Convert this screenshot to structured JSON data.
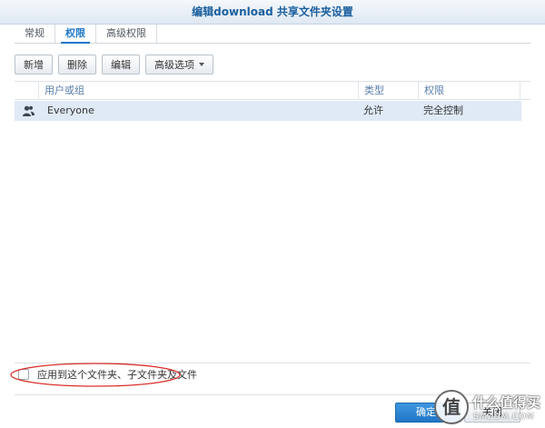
{
  "window": {
    "title": "编辑download 共享文件夹设置"
  },
  "tabs": [
    {
      "label": "常规",
      "active": false
    },
    {
      "label": "权限",
      "active": true
    },
    {
      "label": "高级权限",
      "active": false
    }
  ],
  "toolbar": {
    "add_label": "新增",
    "delete_label": "删除",
    "edit_label": "编辑",
    "advanced_label": "高级选项"
  },
  "grid": {
    "columns": [
      "用户或组",
      "类型",
      "权限"
    ],
    "rows": [
      {
        "icon": "user-group-icon",
        "name": "Everyone",
        "type": "允许",
        "permission": "完全控制"
      }
    ]
  },
  "apply": {
    "label": "应用到这个文件夹、子文件夹及文件",
    "checked": false
  },
  "footer": {
    "ok_label": "确定",
    "close_label": "关闭"
  },
  "watermark": {
    "glyph": "值",
    "text": "什么值得买",
    "domain": "SMZDM.COM"
  },
  "colors": {
    "accent": "#1e78c8",
    "selection": "#dfeaf6",
    "annotation": "#d9302a"
  }
}
